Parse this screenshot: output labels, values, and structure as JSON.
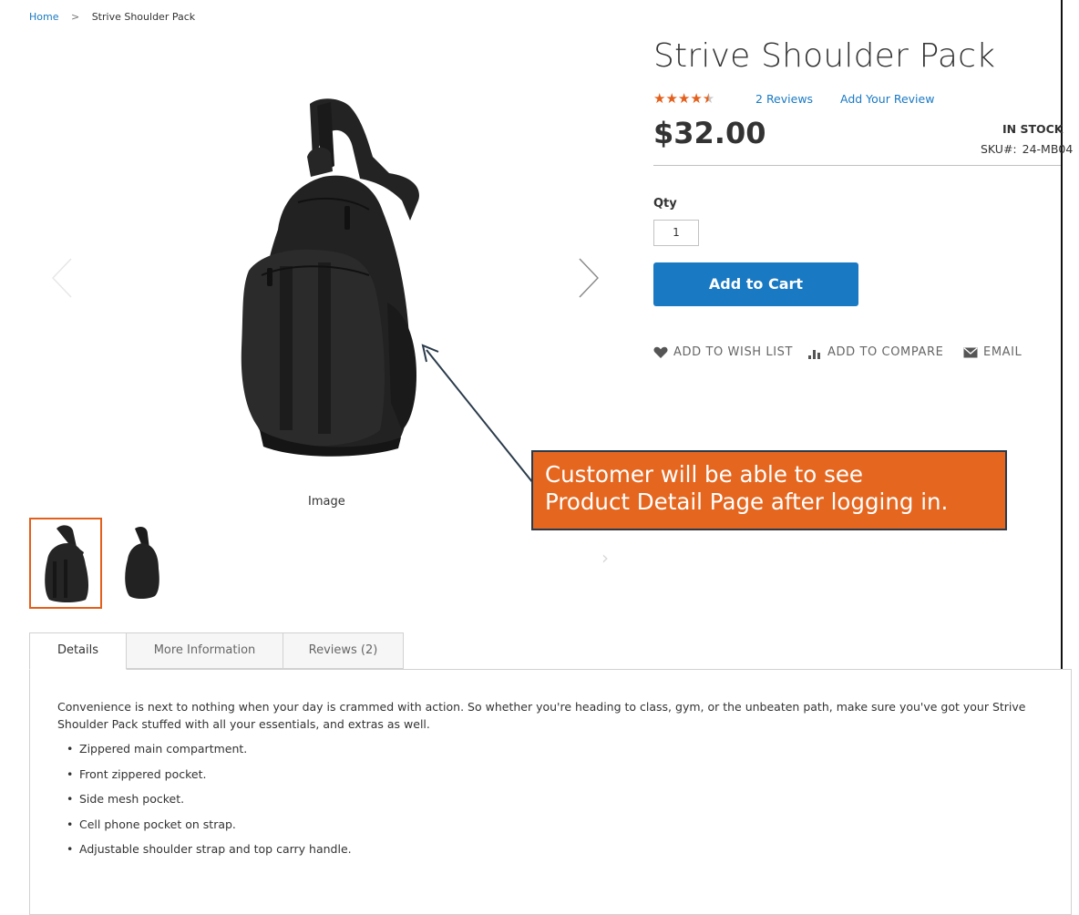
{
  "breadcrumb": {
    "home": "Home",
    "separator": ">",
    "current": "Strive Shoulder Pack"
  },
  "gallery": {
    "caption": "Image",
    "prev_glyph": "‹",
    "next_glyph": "›",
    "thumb_next_glyph": "›",
    "active_thumb": 1,
    "thumb_count": 2
  },
  "product": {
    "title": "Strive Shoulder Pack",
    "rating_stars": "★★★★",
    "rating_half": "★",
    "rating_value": 4.5,
    "reviews_count_text": "2",
    "reviews_word": "Reviews",
    "add_review": "Add Your Review",
    "price": "$32.00",
    "stock": "IN STOCK",
    "sku_label": "SKU#:",
    "sku_value": "24-MB04",
    "qty_label": "Qty",
    "qty_value": "1",
    "add_to_cart": "Add to Cart",
    "wish_list": "ADD TO WISH LIST",
    "compare": "ADD TO COMPARE",
    "email": "EMAIL"
  },
  "callout": {
    "line1": "Customer will be able to see",
    "line2": "Product Detail Page after logging in."
  },
  "tabs": [
    {
      "label": "Details"
    },
    {
      "label": "More Information"
    },
    {
      "label": "Reviews (2)"
    }
  ],
  "details": {
    "description": "Convenience is next to nothing when your day is crammed with action. So whether you're heading to class, gym, or the unbeaten path, make sure you've got your Strive Shoulder Pack stuffed with all your essentials, and extras as well.",
    "features": [
      "Zippered main compartment.",
      "Front zippered pocket.",
      "Side mesh pocket.",
      "Cell phone pocket on strap.",
      "Adjustable shoulder strap and top carry handle."
    ]
  },
  "colors": {
    "link": "#1979c3",
    "button": "#1979c3",
    "accent": "#e35f1b",
    "callout_bg": "#e5661f",
    "callout_border": "#2a3a4a"
  },
  "icons": {
    "wish_list": "heart-icon",
    "compare": "bar-chart-icon",
    "email": "envelope-icon"
  }
}
